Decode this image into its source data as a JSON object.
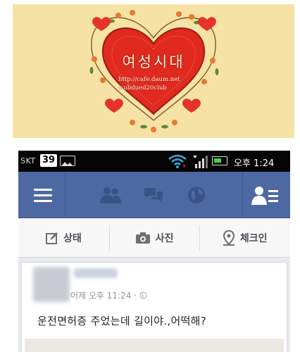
{
  "banner": {
    "title": "여성시대",
    "url_line1": "http://cafe.daum.net",
    "url_line2": "/subdued20club",
    "background": "#f7e2a5",
    "heart_color": "#e0291f"
  },
  "statusbar": {
    "carrier": "SKT",
    "badge": "39",
    "time": "오후 1:24"
  },
  "navbar": {
    "color": "#4e69a2",
    "icons": [
      "menu-icon",
      "friends-icon",
      "messages-icon",
      "globe-icon",
      "friend-requests-icon"
    ]
  },
  "composer": {
    "status_label": "상태",
    "photo_label": "사진",
    "checkin_label": "체크인"
  },
  "post": {
    "meta": "어제 오후 11:24 · ",
    "text": "운전면허증 주었는데 길이야.,어떡해?"
  }
}
